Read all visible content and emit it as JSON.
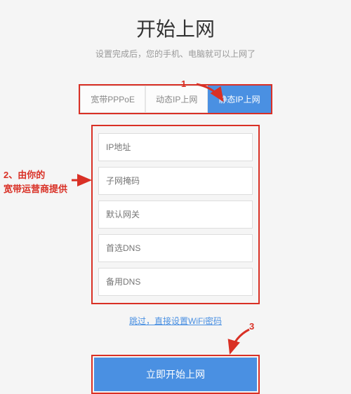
{
  "header": {
    "title": "开始上网",
    "subtitle": "设置完成后，您的手机、电脑就可以上网了"
  },
  "tabs": {
    "pppoe": "宽带PPPoE",
    "dynamic": "动态IP上网",
    "static": "静态IP上网"
  },
  "fields": {
    "ip": "IP地址",
    "subnet": "子网掩码",
    "gateway": "默认网关",
    "dns1": "首选DNS",
    "dns2": "备用DNS"
  },
  "links": {
    "skip": "跳过，直接设置WiFi密码"
  },
  "buttons": {
    "submit": "立即开始上网"
  },
  "annotations": {
    "step1": "1",
    "step2_line1": "2、由你的",
    "step2_line2": "宽带运营商提供",
    "step3": "3"
  }
}
